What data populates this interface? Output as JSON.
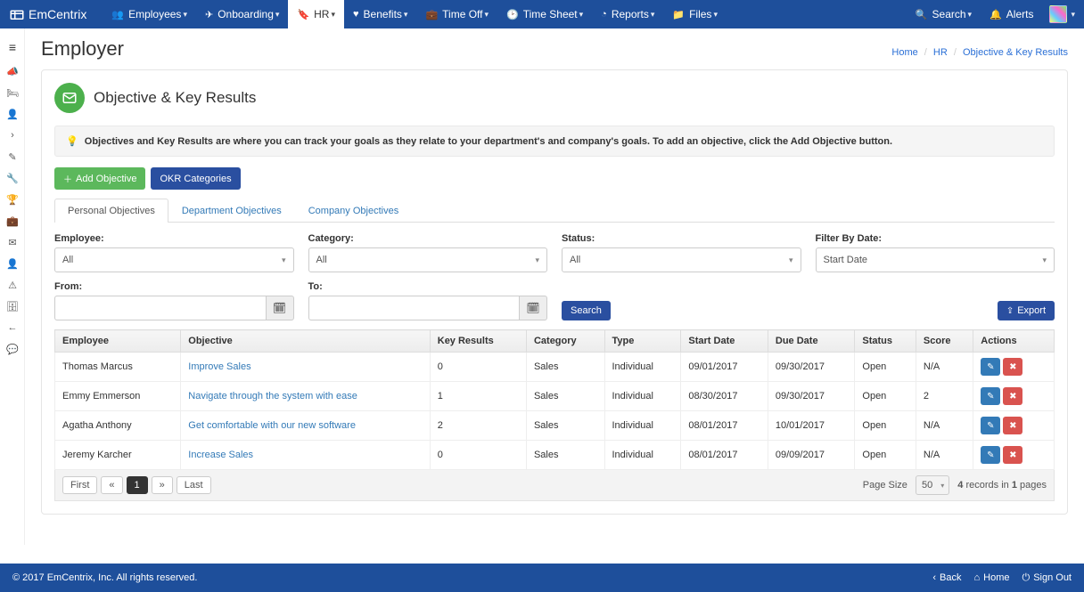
{
  "brand": "EmCentrix",
  "topnav": {
    "items": [
      {
        "label": "Employees",
        "icon": "users"
      },
      {
        "label": "Onboarding",
        "icon": "plane"
      },
      {
        "label": "HR",
        "icon": "bookmark",
        "active": true
      },
      {
        "label": "Benefits",
        "icon": "heart"
      },
      {
        "label": "Time Off",
        "icon": "briefcase"
      },
      {
        "label": "Time Sheet",
        "icon": "clock"
      },
      {
        "label": "Reports",
        "icon": "pie"
      },
      {
        "label": "Files",
        "icon": "folder"
      }
    ],
    "search": "Search",
    "alerts": "Alerts"
  },
  "page_title": "Employer",
  "breadcrumb": {
    "home": "Home",
    "hr": "HR",
    "current": "Objective & Key Results"
  },
  "section": {
    "title": "Objective & Key Results",
    "info_bold": "Objectives and Key Results are where you can track your goals as they relate to your department's and company's goals. To add an objective, click the Add Objective button."
  },
  "buttons": {
    "add": "Add Objective",
    "categories": "OKR Categories",
    "search": "Search",
    "export": "Export"
  },
  "tabs": [
    "Personal Objectives",
    "Department Objectives",
    "Company Objectives"
  ],
  "filters": {
    "employee_label": "Employee:",
    "employee_val": "All",
    "category_label": "Category:",
    "category_val": "All",
    "status_label": "Status:",
    "status_val": "All",
    "date_label": "Filter By Date:",
    "date_val": "Start Date",
    "from_label": "From:",
    "to_label": "To:"
  },
  "table": {
    "headers": [
      "Employee",
      "Objective",
      "Key Results",
      "Category",
      "Type",
      "Start Date",
      "Due Date",
      "Status",
      "Score",
      "Actions"
    ],
    "rows": [
      {
        "employee": "Thomas Marcus",
        "objective": "Improve Sales",
        "key_results": "0",
        "category": "Sales",
        "type": "Individual",
        "start": "09/01/2017",
        "due": "09/30/2017",
        "status": "Open",
        "score": "N/A"
      },
      {
        "employee": "Emmy Emmerson",
        "objective": "Navigate through the system with ease",
        "key_results": "1",
        "category": "Sales",
        "type": "Individual",
        "start": "08/30/2017",
        "due": "09/30/2017",
        "status": "Open",
        "score": "2"
      },
      {
        "employee": "Agatha Anthony",
        "objective": "Get comfortable with our new software",
        "key_results": "2",
        "category": "Sales",
        "type": "Individual",
        "start": "08/01/2017",
        "due": "10/01/2017",
        "status": "Open",
        "score": "N/A"
      },
      {
        "employee": "Jeremy Karcher",
        "objective": "Increase Sales",
        "key_results": "0",
        "category": "Sales",
        "type": "Individual",
        "start": "08/01/2017",
        "due": "09/09/2017",
        "status": "Open",
        "score": "N/A"
      }
    ]
  },
  "pager": {
    "first": "First",
    "prev": "«",
    "page": "1",
    "next": "»",
    "last": "Last",
    "page_size_label": "Page Size",
    "page_size": "50",
    "records_a": "4",
    "records_b": "records in",
    "records_c": "1",
    "records_d": "pages"
  },
  "footer": {
    "copyright": "© 2017 EmCentrix, Inc. All rights reserved.",
    "back": "Back",
    "home": "Home",
    "signout": "Sign Out"
  }
}
